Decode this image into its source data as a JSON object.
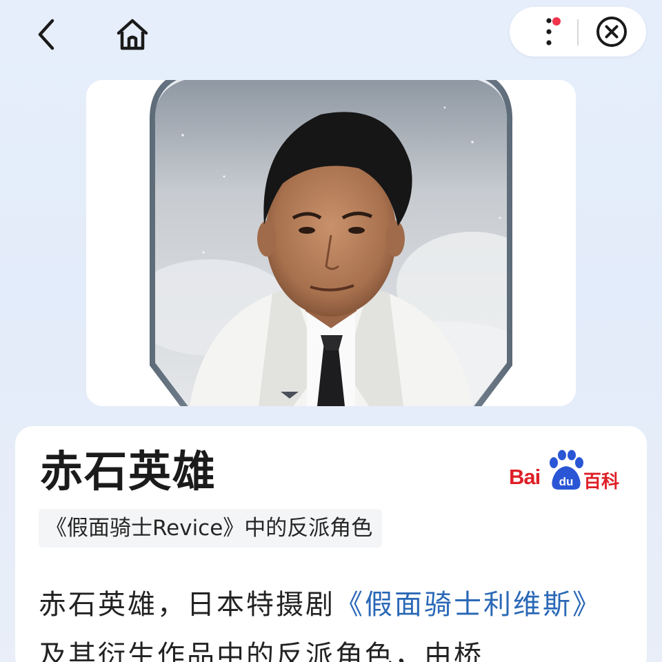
{
  "topbar": {
    "back_icon": "chevron-left-icon",
    "home_icon": "home-icon",
    "more_icon": "more-vertical-icon",
    "close_icon": "close-circle-icon",
    "notification_color": "#f0344c"
  },
  "portrait": {
    "icon": "person-portrait",
    "frame_style": "silver-badge"
  },
  "entry": {
    "title": "赤石英雄",
    "source_logo_bai": "Bai",
    "source_logo_du": "du",
    "source_logo_text": "百科",
    "subtitle": "《假面骑士Revice》中的反派角色",
    "summary_part1": "赤石英雄，日本特摄剧",
    "summary_link": "《假面骑士利维斯》",
    "summary_part2": "及其衍生作品中的反派角色，由桥"
  },
  "colors": {
    "link": "#2a68b6",
    "brand_red": "#de1f27",
    "background": "#e4ecfa"
  }
}
